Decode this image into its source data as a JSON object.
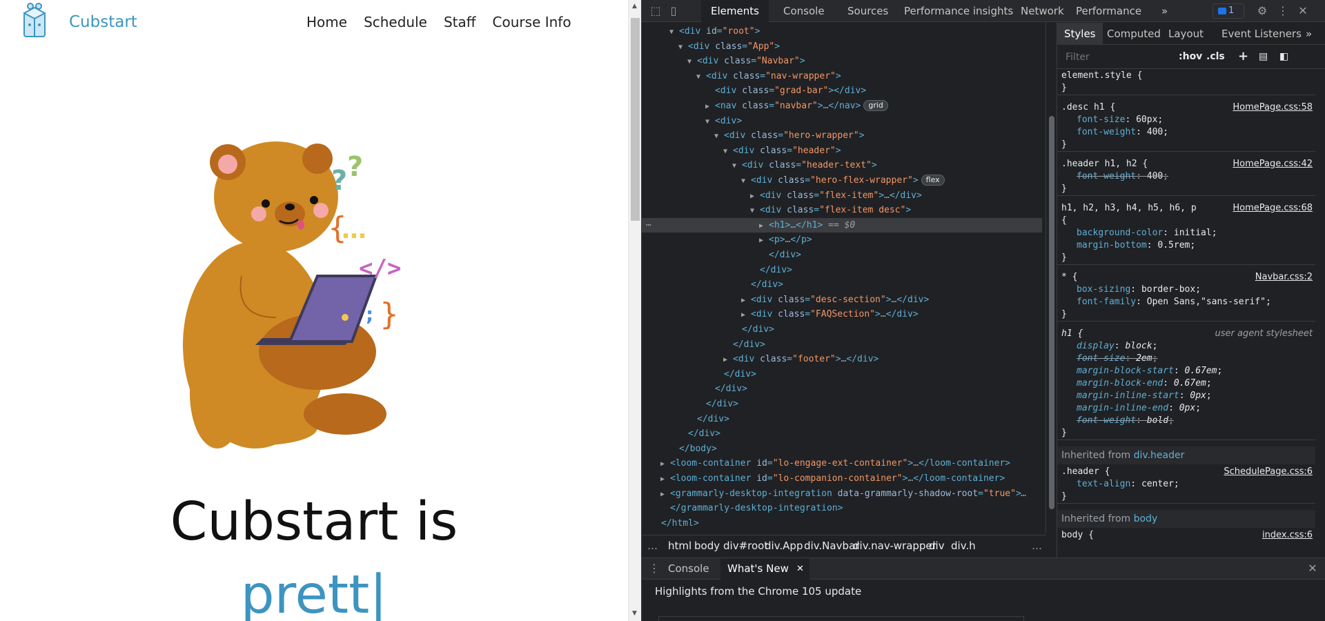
{
  "site": {
    "brand": "Cubstart",
    "nav": [
      "Home",
      "Schedule",
      "Staff",
      "Course Info"
    ],
    "hero_line1": "Cubstart is",
    "hero_line2": "prett|"
  },
  "devtools": {
    "tabs": [
      "Elements",
      "Console",
      "Sources",
      "Performance insights",
      "Network",
      "Performance"
    ],
    "active_tab": "Elements",
    "more_tabs": "»",
    "issues_count": "1",
    "dom": [
      {
        "t": "open",
        "d": 1,
        "tri": "▼",
        "tag": "div",
        "attrs": [
          [
            "id",
            "root"
          ]
        ]
      },
      {
        "t": "open",
        "d": 2,
        "tri": "▼",
        "tag": "div",
        "attrs": [
          [
            "class",
            "App"
          ]
        ]
      },
      {
        "t": "open",
        "d": 3,
        "tri": "▼",
        "tag": "div",
        "attrs": [
          [
            "class",
            "Navbar"
          ]
        ]
      },
      {
        "t": "open",
        "d": 4,
        "tri": "▼",
        "tag": "div",
        "attrs": [
          [
            "class",
            "nav-wrapper"
          ]
        ]
      },
      {
        "t": "full",
        "d": 5,
        "tri": "",
        "tag": "div",
        "attrs": [
          [
            "class",
            "grad-bar"
          ]
        ],
        "inner": ""
      },
      {
        "t": "full",
        "d": 5,
        "tri": "▶",
        "tag": "nav",
        "attrs": [
          [
            "class",
            "navbar"
          ]
        ],
        "inner": "…",
        "pill": "grid"
      },
      {
        "t": "open",
        "d": 5,
        "tri": "▼",
        "tag": "div",
        "attrs": []
      },
      {
        "t": "open",
        "d": 6,
        "tri": "▼",
        "tag": "div",
        "attrs": [
          [
            "class",
            "hero-wrapper"
          ]
        ]
      },
      {
        "t": "open",
        "d": 7,
        "tri": "▼",
        "tag": "div",
        "attrs": [
          [
            "class",
            "header"
          ]
        ]
      },
      {
        "t": "open",
        "d": 8,
        "tri": "▼",
        "tag": "div",
        "attrs": [
          [
            "class",
            "header-text"
          ]
        ]
      },
      {
        "t": "open",
        "d": 9,
        "tri": "▼",
        "tag": "div",
        "attrs": [
          [
            "class",
            "hero-flex-wrapper"
          ]
        ],
        "pill": "flex"
      },
      {
        "t": "full",
        "d": 10,
        "tri": "▶",
        "tag": "div",
        "attrs": [
          [
            "class",
            "flex-item"
          ]
        ],
        "inner": "…"
      },
      {
        "t": "open",
        "d": 10,
        "tri": "▼",
        "tag": "div",
        "attrs": [
          [
            "class",
            "flex-item desc"
          ]
        ]
      },
      {
        "t": "full",
        "d": 11,
        "tri": "▶",
        "tag": "h1",
        "attrs": [],
        "inner": "…",
        "selected": true,
        "suffix": " == $0"
      },
      {
        "t": "full",
        "d": 11,
        "tri": "▶",
        "tag": "p",
        "attrs": [],
        "inner": "…"
      },
      {
        "t": "close",
        "d": 11,
        "tag": "div"
      },
      {
        "t": "close",
        "d": 10,
        "tag": "div"
      },
      {
        "t": "close",
        "d": 9,
        "tag": "div"
      },
      {
        "t": "full",
        "d": 9,
        "tri": "▶",
        "tag": "div",
        "attrs": [
          [
            "class",
            "desc-section"
          ]
        ],
        "inner": "…"
      },
      {
        "t": "full",
        "d": 9,
        "tri": "▶",
        "tag": "div",
        "attrs": [
          [
            "class",
            "FAQSection"
          ]
        ],
        "inner": "…"
      },
      {
        "t": "close",
        "d": 8,
        "tag": "div"
      },
      {
        "t": "close",
        "d": 7,
        "tag": "div"
      },
      {
        "t": "full",
        "d": 7,
        "tri": "▶",
        "tag": "div",
        "attrs": [
          [
            "class",
            "footer"
          ]
        ],
        "inner": "…"
      },
      {
        "t": "close",
        "d": 6,
        "tag": "div"
      },
      {
        "t": "close",
        "d": 5,
        "tag": "div"
      },
      {
        "t": "close",
        "d": 4,
        "tag": "div"
      },
      {
        "t": "close",
        "d": 3,
        "tag": "div"
      },
      {
        "t": "close",
        "d": 2,
        "tag": "div"
      },
      {
        "t": "close",
        "d": 1,
        "tag": "body"
      },
      {
        "t": "full",
        "d": 0,
        "tri": "▶",
        "tag": "loom-container",
        "attrs": [
          [
            "id",
            "lo-engage-ext-container"
          ]
        ],
        "inner": "…"
      },
      {
        "t": "full",
        "d": 0,
        "tri": "▶",
        "tag": "loom-container",
        "attrs": [
          [
            "id",
            "lo-companion-container"
          ]
        ],
        "inner": "…"
      },
      {
        "t": "open",
        "d": 0,
        "tri": "▶",
        "tag": "grammarly-desktop-integration",
        "attrs": [
          [
            "data-grammarly-shadow-root",
            "true"
          ]
        ],
        "suffix": "…"
      },
      {
        "t": "close",
        "d": 0,
        "tag": "grammarly-desktop-integration"
      },
      {
        "t": "close",
        "d": -1,
        "tag": "html"
      }
    ],
    "breadcrumbs": [
      "html",
      "body",
      "div#root",
      "div.App",
      "div.Navbar",
      "div.nav-wrapper",
      "div",
      "div.h"
    ],
    "styles_tabs": [
      "Styles",
      "Computed",
      "Layout",
      "Event Listeners"
    ],
    "filter_placeholder": "Filter",
    "filter_buttons": [
      ":hov",
      ".cls"
    ],
    "rules": [
      {
        "selector": "element.style {",
        "source": "",
        "props": []
      },
      {
        "selector": ".desc h1 {",
        "source": "HomePage.css:58",
        "props": [
          [
            "font-size",
            "60px",
            false
          ],
          [
            "font-weight",
            "400",
            false
          ]
        ]
      },
      {
        "selector": ".header h1, h2 {",
        "source": "HomePage.css:42",
        "props": [
          [
            "font-weight",
            "400",
            true
          ]
        ]
      },
      {
        "selector": "h1, h2, h3, h4, h5, h6, p",
        "selector2": "{",
        "source": "HomePage.css:68",
        "props": [
          [
            "background-color",
            "initial",
            false
          ],
          [
            "margin-bottom",
            "0.5rem",
            false
          ]
        ]
      },
      {
        "selector": "* {",
        "source": "Navbar.css:2",
        "props": [
          [
            "box-sizing",
            "border-box",
            false
          ],
          [
            "font-family",
            "Open Sans,\"sans-serif\"",
            false
          ]
        ]
      },
      {
        "selector": "h1 {",
        "source": "user agent stylesheet",
        "ua": true,
        "props": [
          [
            "display",
            "block",
            false
          ],
          [
            "font-size",
            "2em",
            true
          ],
          [
            "margin-block-start",
            "0.67em",
            false
          ],
          [
            "margin-block-end",
            "0.67em",
            false
          ],
          [
            "margin-inline-start",
            "0px",
            false
          ],
          [
            "margin-inline-end",
            "0px",
            false
          ],
          [
            "font-weight",
            "bold",
            true
          ]
        ]
      }
    ],
    "inherited1": {
      "label": "Inherited from",
      "tag": "div.header"
    },
    "header_rule": {
      "selector": ".header {",
      "source": "SchedulePage.css:6",
      "props": [
        [
          "text-align",
          "center",
          false
        ]
      ]
    },
    "inherited2": {
      "label": "Inherited from",
      "tag": "body"
    },
    "body_rule": {
      "selector": "body {",
      "source": "index.css:6"
    },
    "drawer_tabs": [
      "Console",
      "What's New"
    ],
    "drawer_text": "Highlights from the Chrome 105 update"
  }
}
